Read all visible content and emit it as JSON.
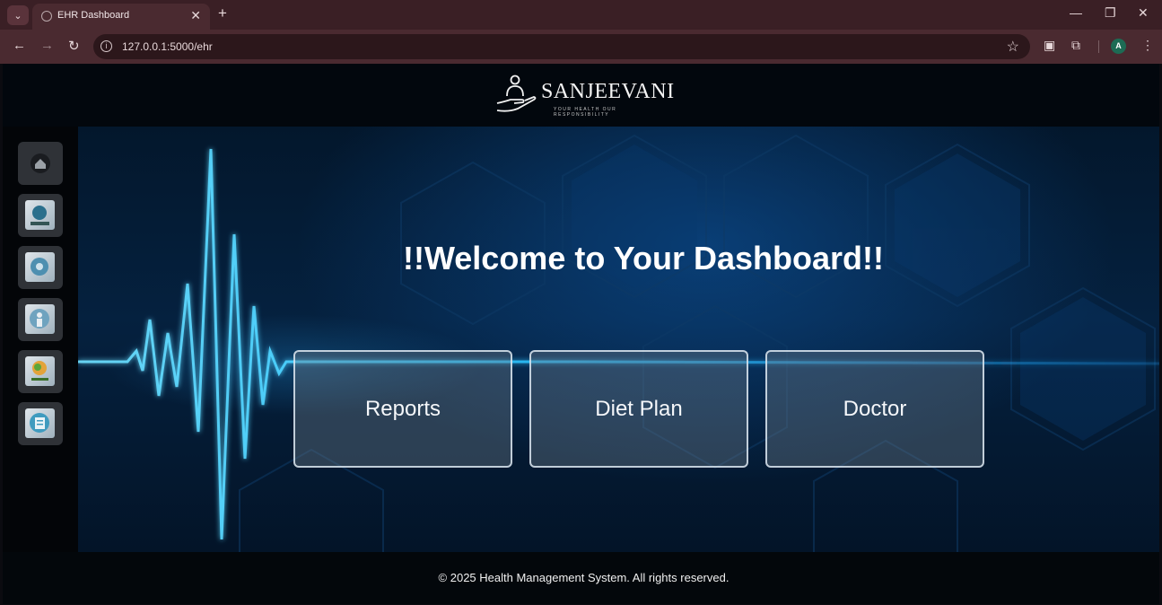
{
  "browser": {
    "tab_title": "EHR Dashboard",
    "url": "127.0.0.1:5000/ehr",
    "profile_initial": "A"
  },
  "header": {
    "logo_text": "SANJEEVANI",
    "logo_tagline": "YOUR HEALTH OUR RESPONSIBILITY"
  },
  "sidebar": {
    "items": [
      {
        "name": "home",
        "icon": "home-icon"
      },
      {
        "name": "find-doctor",
        "icon": "find-doctor-icon"
      },
      {
        "name": "health-settings",
        "icon": "health-gear-icon"
      },
      {
        "name": "profile",
        "icon": "person-icon"
      },
      {
        "name": "diet-plan",
        "icon": "diet-plan-icon"
      },
      {
        "name": "reports",
        "icon": "medical-report-icon"
      }
    ]
  },
  "main": {
    "welcome": "!!Welcome to Your Dashboard!!",
    "cards": [
      {
        "label": "Reports"
      },
      {
        "label": "Diet Plan"
      },
      {
        "label": "Doctor"
      }
    ]
  },
  "footer": {
    "text": "© 2025 Health Management System. All rights reserved."
  },
  "colors": {
    "browser_frame": "#3a1f25",
    "hero_blue": "#05213f",
    "heartbeat_cyan": "#2fc6ff"
  }
}
